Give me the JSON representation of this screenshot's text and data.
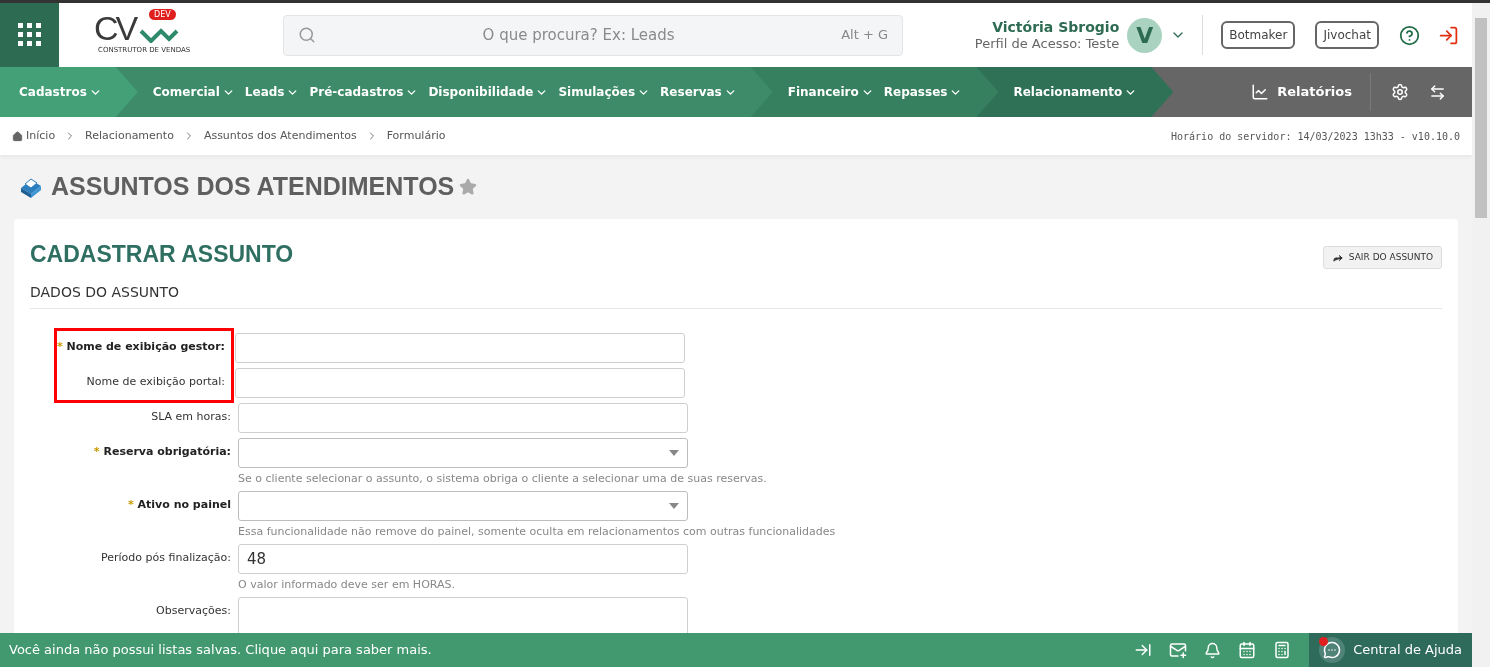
{
  "logo": {
    "letters": "CV",
    "badge": "DEV",
    "tagline": "CONSTRUTOR DE VENDAS"
  },
  "search": {
    "placeholder": "O que procura? Ex: Leads",
    "shortcut": "Alt + G"
  },
  "user": {
    "name": "Victória Sbrogio",
    "profile": "Perfil de Acesso: Teste",
    "initial": "V"
  },
  "header_buttons": [
    "Botmaker",
    "Jivochat"
  ],
  "nav": {
    "groups": [
      {
        "color": "#43a077",
        "items": [
          "Cadastros"
        ]
      },
      {
        "color": "#3d8b68",
        "items": [
          "Comercial",
          "Leads",
          "Pré-cadastros",
          "Disponibilidade",
          "Simulações",
          "Reservas"
        ]
      },
      {
        "color": "#37805f",
        "items": [
          "Financeiro",
          "Repasses"
        ]
      },
      {
        "color": "#2f7157",
        "items": [
          "Relacionamento"
        ]
      }
    ],
    "reports": "Relatórios"
  },
  "breadcrumb": [
    "Início",
    "Relacionamento",
    "Assuntos dos Atendimentos",
    "Formulário"
  ],
  "server_time": "Horário do servidor: 14/03/2023 13h33 - v10.10.0",
  "page_title": "ASSUNTOS DOS ATENDIMENTOS",
  "card": {
    "title": "CADASTRAR ASSUNTO",
    "exit_button": "SAIR DO ASSUNTO",
    "section": "DADOS DO ASSUNTO",
    "required_mark": "*",
    "fields": [
      {
        "kind": "text",
        "label": "Nome de exibição gestor:",
        "required": true,
        "highlighted": true
      },
      {
        "kind": "text",
        "label": "Nome de exibição portal:",
        "required": false,
        "highlighted": true
      },
      {
        "kind": "text",
        "label": "SLA em horas:",
        "required": false,
        "highlighted": false
      },
      {
        "kind": "select",
        "label": "Reserva obrigatória:",
        "required": true,
        "highlighted": false,
        "hint": "Se o cliente selecionar o assunto, o sistema obriga o cliente a selecionar uma de suas reservas."
      },
      {
        "kind": "select",
        "label": "Ativo no painel",
        "required": true,
        "highlighted": false,
        "hint": "Essa funcionalidade não remove do painel, somente oculta em relacionamentos com outras funcionalidades"
      },
      {
        "kind": "text",
        "label": "Período pós finalização:",
        "required": false,
        "highlighted": false,
        "value": "48",
        "hint": "O valor informado deve ser em HORAS."
      },
      {
        "kind": "textarea",
        "label": "Observações:",
        "required": false,
        "highlighted": false
      }
    ]
  },
  "bottom_bar": {
    "message": "Você ainda não possui listas salvas. Clique aqui para saber mais.",
    "help": "Central de Ajuda"
  }
}
